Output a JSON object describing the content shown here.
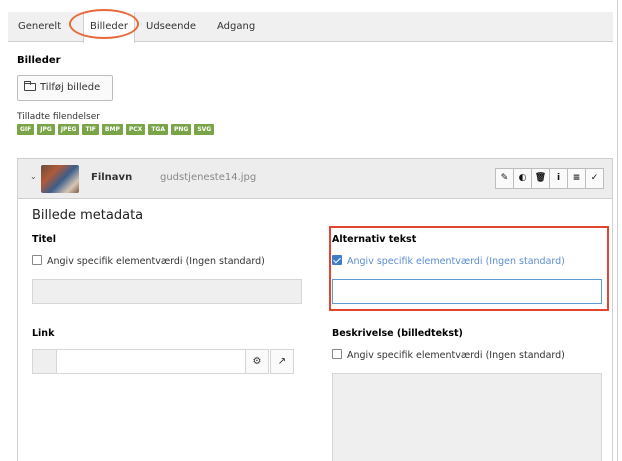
{
  "tabs": [
    {
      "label": "Generelt"
    },
    {
      "label": "Billeder"
    },
    {
      "label": "Udseende"
    },
    {
      "label": "Adgang"
    }
  ],
  "section": {
    "title": "Billeder",
    "add_button": "Tilføj billede",
    "allowed_label": "Tilladte filendelser",
    "extensions": [
      "GIF",
      "JPG",
      "JPEG",
      "TIF",
      "BMP",
      "PCX",
      "TGA",
      "PNG",
      "SVG"
    ]
  },
  "file": {
    "name_label": "Filnavn",
    "name": "gudstjeneste14.jpg",
    "icons": [
      "pencil-icon",
      "eye-toggle-icon",
      "trash-icon",
      "info-icon",
      "menu-icon",
      "check-icon"
    ]
  },
  "metadata": {
    "title": "Billede metadata",
    "titel": {
      "label": "Titel",
      "checkbox": "Angiv specifik elementværdi (Ingen standard)",
      "checked": false,
      "value": ""
    },
    "alt": {
      "label": "Alternativ tekst",
      "checkbox": "Angiv specifik elementværdi (Ingen standard)",
      "checked": true,
      "value": ""
    },
    "link": {
      "label": "Link",
      "value": ""
    },
    "beskrivelse": {
      "label": "Beskrivelse (billedtekst)",
      "checkbox": "Angiv specifik elementværdi (Ingen standard)",
      "checked": false
    }
  },
  "colors": {
    "extension_badge": "#79a548",
    "highlight": "#e2452f",
    "checked": "#3d7ecb"
  }
}
